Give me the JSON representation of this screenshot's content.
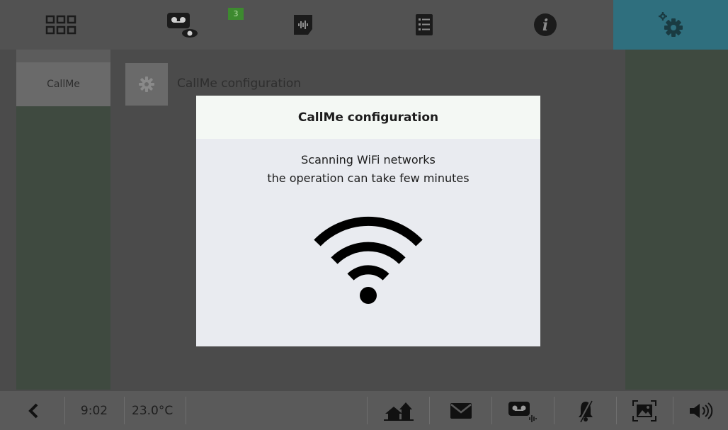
{
  "topbar": {
    "tabs": [
      {
        "name": "apps-grid-icon"
      },
      {
        "name": "voicemail-view-icon"
      },
      {
        "name": "audio-memo-icon"
      },
      {
        "name": "list-icon"
      },
      {
        "name": "info-icon"
      },
      {
        "name": "settings-gear-icon"
      }
    ],
    "badge_count": "3",
    "active_color": "#2f6f7e"
  },
  "sidebar": {
    "items": [
      {
        "label": "CallMe"
      }
    ]
  },
  "main": {
    "section_title": "CallMe configuration"
  },
  "modal": {
    "title": "CallMe configuration",
    "line1": "Scanning WiFi networks",
    "line2": "the operation can take few minutes",
    "icon": "wifi-icon"
  },
  "bottombar": {
    "back_icon": "back-chevron-icon",
    "time": "9:02",
    "temperature": "23.0°C",
    "icons": [
      "home-icon",
      "mail-icon",
      "voicemail-icon",
      "bell-mute-icon",
      "picture-frame-icon",
      "volume-icon"
    ]
  }
}
